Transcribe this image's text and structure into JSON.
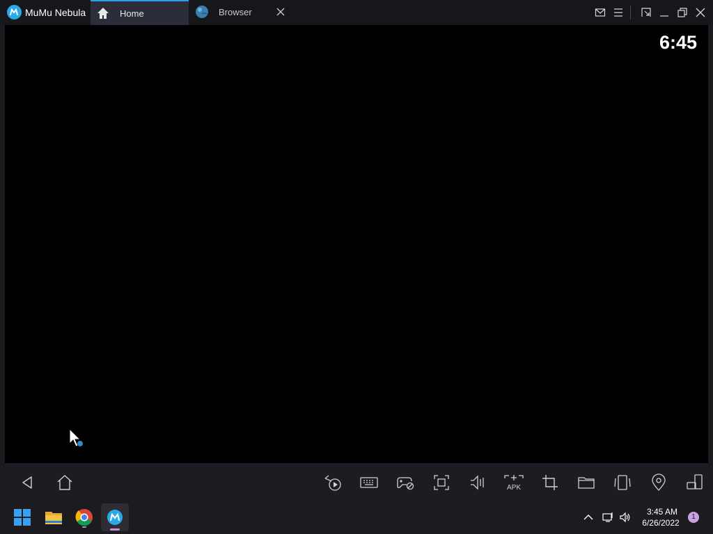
{
  "titlebar": {
    "app_name": "MuMu Nebula",
    "tabs": [
      {
        "label": "Home",
        "icon": "home-icon",
        "active": true
      },
      {
        "label": "Browser",
        "icon": "globe-icon",
        "active": false
      }
    ],
    "window_icons": [
      "mail-icon",
      "menu-icon",
      "resize-icon",
      "minimize-icon",
      "restore-icon",
      "close-icon"
    ]
  },
  "screen": {
    "clock": "6:45"
  },
  "nav_bar": {
    "left": [
      "back-icon",
      "home-icon"
    ],
    "tools": [
      "video-record-icon",
      "keyboard-icon",
      "gamepad-icon",
      "fullscreen-icon",
      "volume-icon",
      "apk-icon",
      "crop-icon",
      "folder-icon",
      "shake-icon",
      "location-icon",
      "rotate-icon"
    ],
    "apk_label": "APK"
  },
  "taskbar": {
    "apps": [
      "windows-start-icon",
      "file-explorer-icon",
      "chrome-icon",
      "mumu-icon"
    ],
    "time": "3:45 AM",
    "date": "6/26/2022",
    "notification_count": "1"
  },
  "colors": {
    "accent": "#2aa0f0",
    "titlebar_bg": "#16171b",
    "screen_bg": "#000000",
    "nav_bg": "#1c1d22",
    "taskbar_bg": "#1c1c20"
  }
}
